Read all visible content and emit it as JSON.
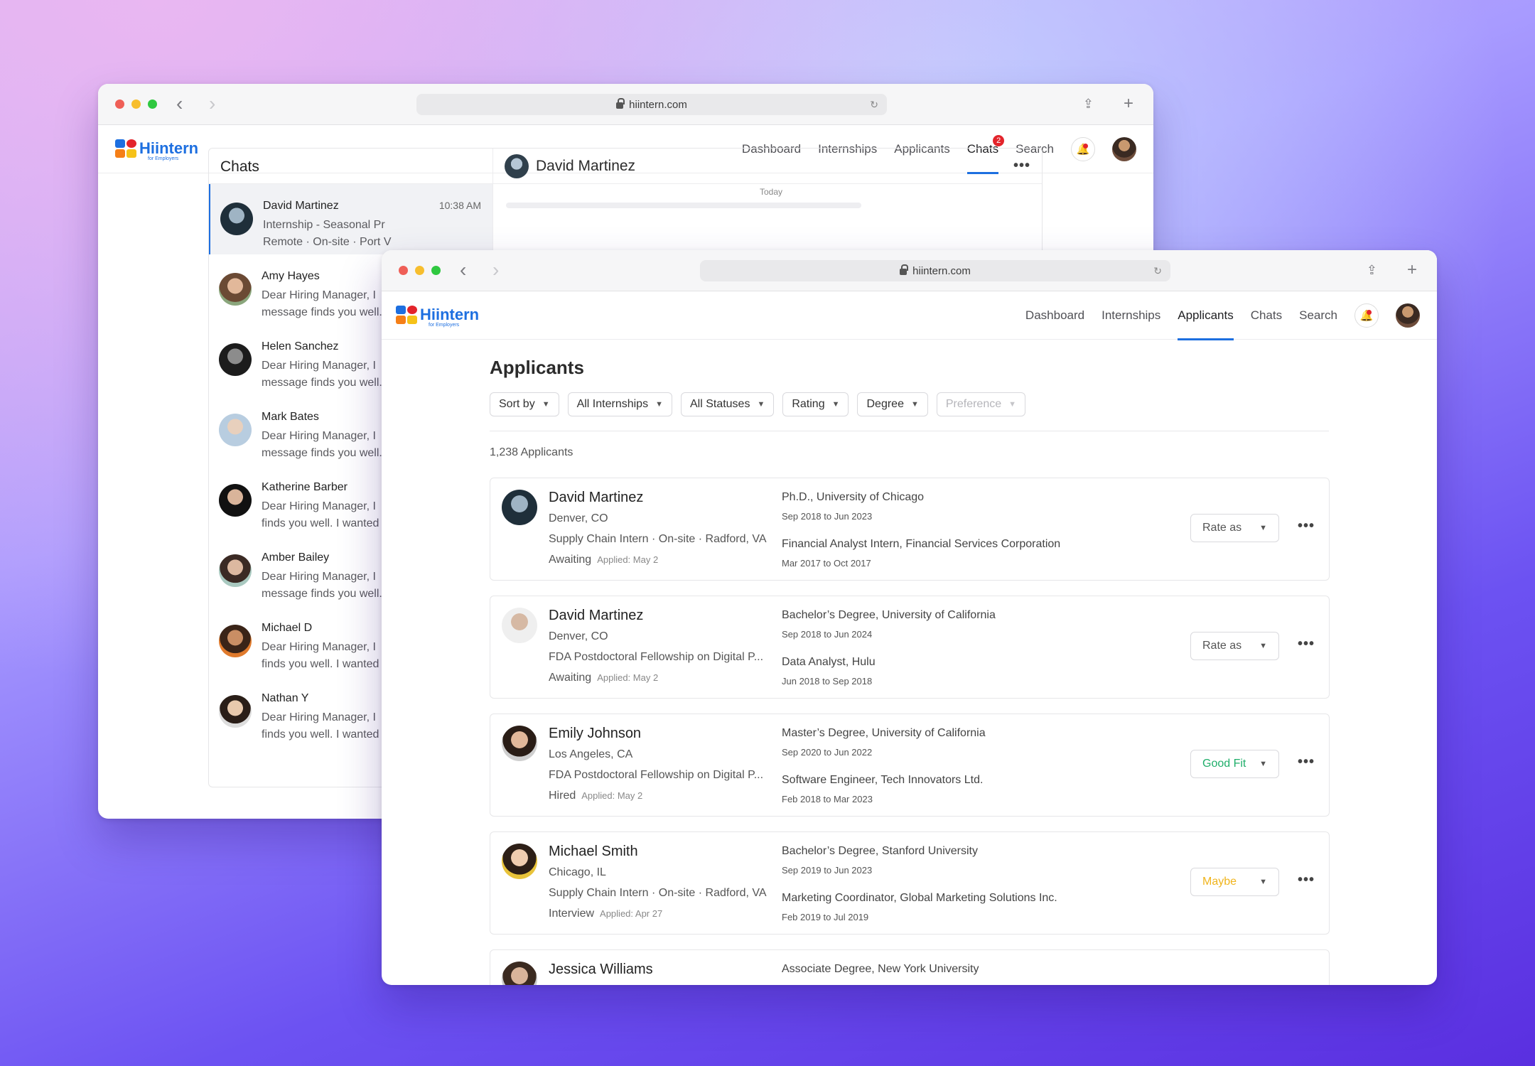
{
  "url": "hiintern.com",
  "logo": {
    "word": "Hiintern",
    "sub": "for Employers"
  },
  "nav": {
    "dashboard": "Dashboard",
    "internships": "Internships",
    "applicants": "Applicants",
    "chats": "Chats",
    "search": "Search",
    "chats_badge": "2"
  },
  "chats": {
    "title": "Chats",
    "active_contact": "David Martinez",
    "day_divider": "Today",
    "items": [
      {
        "name": "David Martinez",
        "time": "10:38 AM",
        "line1": "Internship - Seasonal Pr",
        "line2": "Remote · On-site · Port V"
      },
      {
        "name": "Amy Hayes",
        "line1": "Dear Hiring Manager, I",
        "line2": "message finds you well."
      },
      {
        "name": "Helen Sanchez",
        "line1": "Dear Hiring Manager, I",
        "line2": "message finds you well."
      },
      {
        "name": "Mark Bates",
        "line1": "Dear Hiring Manager, I",
        "line2": "message finds you well."
      },
      {
        "name": "Katherine Barber",
        "line1": "Dear Hiring Manager, I",
        "line2": "finds you well. I wanted"
      },
      {
        "name": "Amber Bailey",
        "line1": "Dear Hiring Manager, I",
        "line2": "message finds you well."
      },
      {
        "name": "Michael D",
        "line1": "Dear Hiring Manager, I",
        "line2": "finds you well. I wanted"
      },
      {
        "name": "Nathan Y",
        "line1": "Dear Hiring Manager, I",
        "line2": "finds you well. I wanted"
      }
    ]
  },
  "applicants": {
    "title": "Applicants",
    "filters": [
      "Sort by",
      "All Internships",
      "All Statuses",
      "Rating",
      "Degree",
      "Preference"
    ],
    "count": "1,238 Applicants",
    "cards": [
      {
        "name": "David Martinez",
        "location": "Denver, CO",
        "job": "Supply Chain Intern · On-site · Radford, VA",
        "status": "Awaiting",
        "applied": "Applied: May 2",
        "edu": "Ph.D., University of Chicago",
        "edu_dates": "Sep 2018 to Jun 2023",
        "exp": "Financial Analyst Intern, Financial Services Corporation",
        "exp_dates": "Mar 2017 to Oct 2017",
        "rating": "Rate as",
        "rating_color": "#555555"
      },
      {
        "name": "David Martinez",
        "location": "Denver, CO",
        "job": "FDA Postdoctoral Fellowship on Digital P...",
        "status": "Awaiting",
        "applied": "Applied: May 2",
        "edu": "Bachelor’s Degree, University of California",
        "edu_dates": "Sep 2018 to Jun 2024",
        "exp": "Data Analyst, Hulu",
        "exp_dates": "Jun 2018 to Sep 2018",
        "rating": "Rate as",
        "rating_color": "#555555"
      },
      {
        "name": "Emily Johnson",
        "location": "Los Angeles, CA",
        "job": "FDA Postdoctoral Fellowship on Digital P...",
        "status": "Hired",
        "applied": "Applied: May 2",
        "edu": "Master’s Degree, University of California",
        "edu_dates": "Sep 2020 to Jun 2022",
        "exp": "Software Engineer, Tech Innovators Ltd.",
        "exp_dates": "Feb 2018 to Mar 2023",
        "rating": "Good Fit",
        "rating_color": "#1fae6a"
      },
      {
        "name": "Michael Smith",
        "location": "Chicago, IL",
        "job": "Supply Chain Intern · On-site · Radford, VA",
        "status": "Interview",
        "applied": "Applied: Apr 27",
        "edu": "Bachelor’s Degree, Stanford University",
        "edu_dates": "Sep 2019 to Jun 2023",
        "exp": "Marketing Coordinator, Global Marketing Solutions Inc.",
        "exp_dates": "Feb 2019 to Jul 2019",
        "rating": "Maybe",
        "rating_color": "#f0b41c"
      },
      {
        "name": "Jessica Williams",
        "location": "",
        "job": "",
        "status": "",
        "applied": "",
        "edu": "Associate Degree, New York University",
        "edu_dates": "",
        "exp": "",
        "exp_dates": "",
        "rating": "",
        "rating_color": "#555555"
      }
    ]
  },
  "colors": {
    "accent": "#1d6fe0",
    "badge": "#e3242b"
  }
}
